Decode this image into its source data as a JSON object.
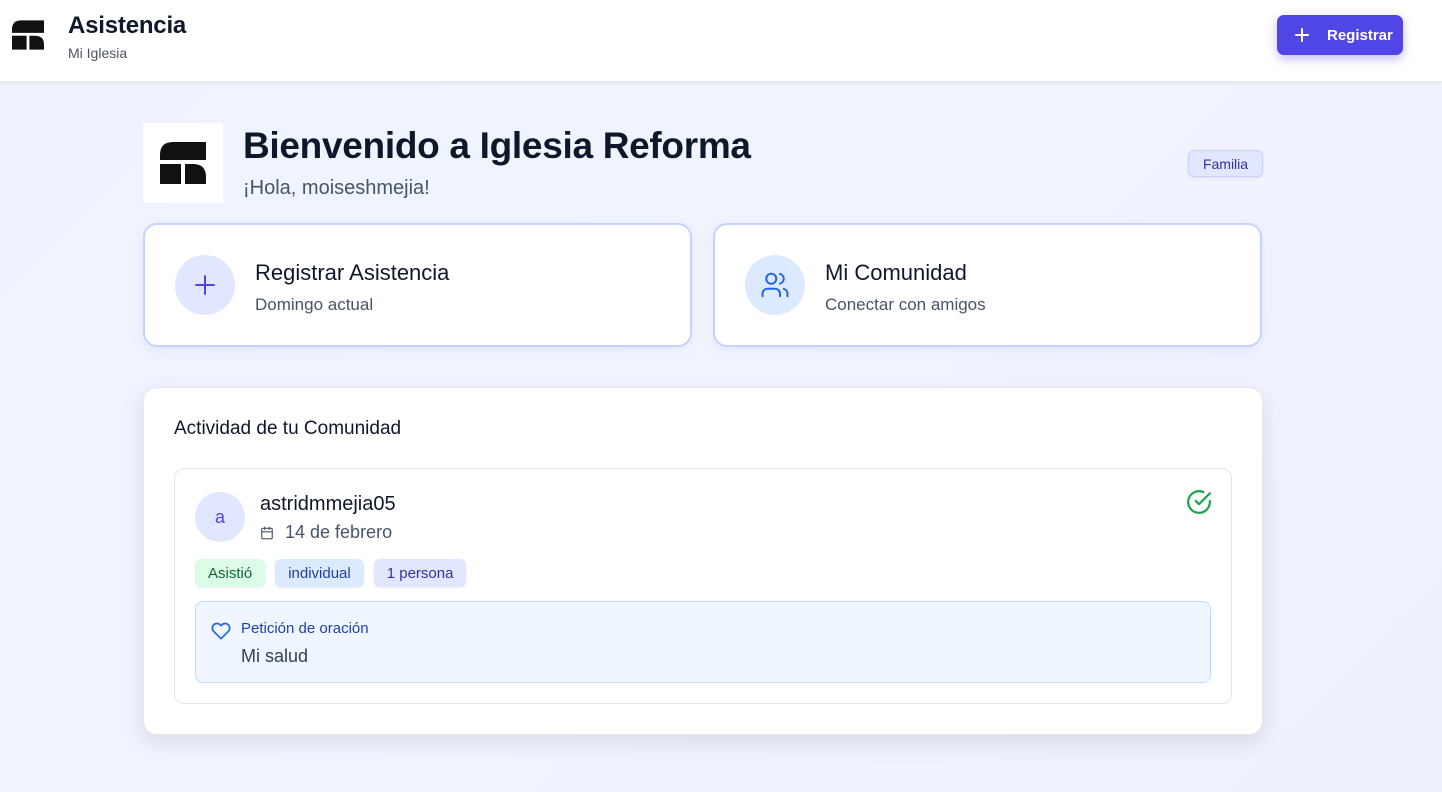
{
  "header": {
    "title": "Asistencia",
    "subtitle": "Mi Iglesia",
    "logo_icon": "church-logo-icon",
    "register_button": {
      "label": "Registrar",
      "icon": "plus-icon"
    }
  },
  "welcome": {
    "title": "Bienvenido a Iglesia Reforma",
    "greeting": "¡Hola, moiseshmejia!",
    "role_badge": "Familia"
  },
  "actions": [
    {
      "title": "Registrar Asistencia",
      "subtitle": "Domingo actual",
      "icon": "plus-icon"
    },
    {
      "title": "Mi Comunidad",
      "subtitle": "Conectar con amigos",
      "icon": "users-icon"
    }
  ],
  "activity": {
    "title": "Actividad de tu Comunidad",
    "items": [
      {
        "avatar_initial": "a",
        "username": "astridmmejia05",
        "date": "14 de febrero",
        "status_icon": "check-circle-icon",
        "tags": [
          "Asistió",
          "individual",
          "1 persona"
        ],
        "prayer": {
          "label": "Petición de oración",
          "text": "Mi salud",
          "icon": "heart-icon"
        }
      }
    ]
  },
  "colors": {
    "primary": "#4f46e5",
    "success": "#16a34a",
    "info": "#2563eb",
    "background": "#eef3fd"
  }
}
